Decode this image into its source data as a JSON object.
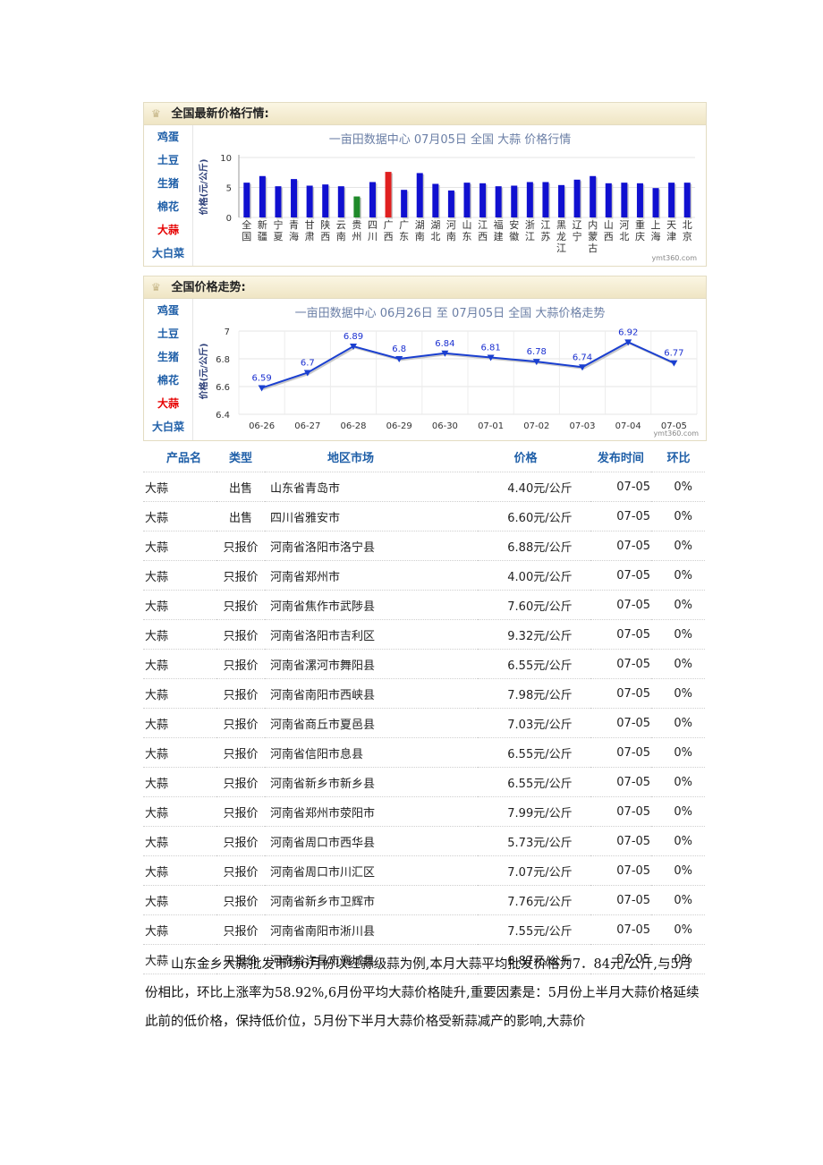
{
  "panel1": {
    "title": "全国最新价格行情:",
    "sidebar": [
      "鸡蛋",
      "土豆",
      "生猪",
      "棉花",
      "大蒜",
      "大白菜"
    ],
    "active_index": 4
  },
  "panel2": {
    "title": "全国价格走势:",
    "sidebar": [
      "鸡蛋",
      "土豆",
      "生猪",
      "棉花",
      "大蒜",
      "大白菜"
    ],
    "active_index": 4
  },
  "chart_data": [
    {
      "type": "bar",
      "title": "一亩田数据中心  07月05日  全国  大蒜  价格行情",
      "ylabel": "价格(元/公斤)",
      "ylim": [
        0,
        10
      ],
      "yticks": [
        "0",
        "5",
        "10"
      ],
      "categories": [
        "全国",
        "新疆",
        "宁夏",
        "青海",
        "甘肃",
        "陕西",
        "云南",
        "贵州",
        "四川",
        "广西",
        "广东",
        "湖南",
        "湖北",
        "河南",
        "山东",
        "江西",
        "福建",
        "安徽",
        "浙江",
        "江苏",
        "黑龙江",
        "辽宁",
        "内蒙古",
        "山西",
        "河北",
        "重庆",
        "上海",
        "天津",
        "北京"
      ],
      "values": [
        5.8,
        6.9,
        5.2,
        6.4,
        5.3,
        5.5,
        5.2,
        3.5,
        5.9,
        7.6,
        4.6,
        7.4,
        5.6,
        4.5,
        5.8,
        5.7,
        5.2,
        5.3,
        5.9,
        5.9,
        5.4,
        6.3,
        6.9,
        5.7,
        5.8,
        5.7,
        4.9,
        5.8,
        5.8
      ],
      "bar_colors": {
        "default": "#1010d0",
        "lowest": "#1f8a2a",
        "highest": "#e02020"
      },
      "lowest_index": 7,
      "highest_index": 9,
      "watermark": "ymt360.com"
    },
    {
      "type": "line",
      "title": "一亩田数据中心  06月26日  至  07月05日  全国  大蒜价格走势",
      "ylabel": "价格(元/公斤)",
      "ylim": [
        6.4,
        7.0
      ],
      "yticks": [
        "6.4",
        "6.6",
        "6.8",
        "7"
      ],
      "x": [
        "06-26",
        "06-27",
        "06-28",
        "06-29",
        "06-30",
        "07-01",
        "07-02",
        "07-03",
        "07-04",
        "07-05"
      ],
      "values": [
        6.59,
        6.7,
        6.89,
        6.8,
        6.84,
        6.81,
        6.78,
        6.74,
        6.92,
        6.77
      ],
      "labels": [
        "6.59",
        "6.7",
        "6.89",
        "6.8",
        "6.84",
        "6.81",
        "6.78",
        "6.74",
        "6.92",
        "6.77"
      ],
      "line_color": "#1a3fd0",
      "watermark": "ymt360.com"
    }
  ],
  "table": {
    "headers": [
      "产品名",
      "类型",
      "地区市场",
      "价格",
      "发布时间",
      "环比"
    ],
    "rows": [
      [
        "大蒜",
        "出售",
        "山东省青岛市",
        "4.40元/公斤",
        "07-05",
        "0%"
      ],
      [
        "大蒜",
        "出售",
        "四川省雅安市",
        "6.60元/公斤",
        "07-05",
        "0%"
      ],
      [
        "大蒜",
        "只报价",
        "河南省洛阳市洛宁县",
        "6.88元/公斤",
        "07-05",
        "0%"
      ],
      [
        "大蒜",
        "只报价",
        "河南省郑州市",
        "4.00元/公斤",
        "07-05",
        "0%"
      ],
      [
        "大蒜",
        "只报价",
        "河南省焦作市武陟县",
        "7.60元/公斤",
        "07-05",
        "0%"
      ],
      [
        "大蒜",
        "只报价",
        "河南省洛阳市吉利区",
        "9.32元/公斤",
        "07-05",
        "0%"
      ],
      [
        "大蒜",
        "只报价",
        "河南省漯河市舞阳县",
        "6.55元/公斤",
        "07-05",
        "0%"
      ],
      [
        "大蒜",
        "只报价",
        "河南省南阳市西峡县",
        "7.98元/公斤",
        "07-05",
        "0%"
      ],
      [
        "大蒜",
        "只报价",
        "河南省商丘市夏邑县",
        "7.03元/公斤",
        "07-05",
        "0%"
      ],
      [
        "大蒜",
        "只报价",
        "河南省信阳市息县",
        "6.55元/公斤",
        "07-05",
        "0%"
      ],
      [
        "大蒜",
        "只报价",
        "河南省新乡市新乡县",
        "6.55元/公斤",
        "07-05",
        "0%"
      ],
      [
        "大蒜",
        "只报价",
        "河南省郑州市荥阳市",
        "7.99元/公斤",
        "07-05",
        "0%"
      ],
      [
        "大蒜",
        "只报价",
        "河南省周口市西华县",
        "5.73元/公斤",
        "07-05",
        "0%"
      ],
      [
        "大蒜",
        "只报价",
        "河南省周口市川汇区",
        "7.07元/公斤",
        "07-05",
        "0%"
      ],
      [
        "大蒜",
        "只报价",
        "河南省新乡市卫辉市",
        "7.76元/公斤",
        "07-05",
        "0%"
      ],
      [
        "大蒜",
        "只报价",
        "河南省南阳市淅川县",
        "7.55元/公斤",
        "07-05",
        "0%"
      ],
      [
        "大蒜",
        "只报价",
        "河南省许昌市襄城县",
        "6.87元/公斤",
        "07-05",
        "0%"
      ]
    ]
  },
  "paragraph": "山东金乡大蒜批发市场6月份以红蒜级蒜为例,本月大蒜平均批发价格为7．84元/公斤,与5月份相比，环比上涨率为58.92%,6月份平均大蒜价格陡升,重要因素是：5月份上半月大蒜价格延续此前的低价格，保持低价位，5月份下半月大蒜价格受新蒜减产的影响,大蒜价"
}
